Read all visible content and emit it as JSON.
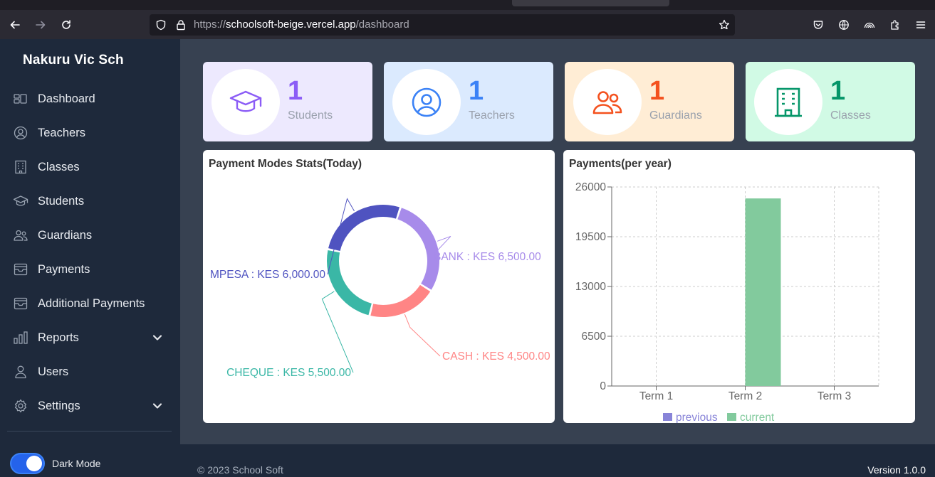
{
  "browser": {
    "url_scheme": "https://",
    "url_host": "schoolsoft-beige.vercel.app",
    "url_path": "/dashboard"
  },
  "sidebar": {
    "brand": "Nakuru Vic Sch",
    "items": [
      {
        "label": "Dashboard",
        "icon": "dashboard-icon"
      },
      {
        "label": "Teachers",
        "icon": "user-circle-icon"
      },
      {
        "label": "Classes",
        "icon": "building-icon"
      },
      {
        "label": "Students",
        "icon": "graduation-cap-icon"
      },
      {
        "label": "Guardians",
        "icon": "users-icon"
      },
      {
        "label": "Payments",
        "icon": "inbox-icon"
      },
      {
        "label": "Additional Payments",
        "icon": "inbox-icon"
      },
      {
        "label": "Reports",
        "icon": "bar-chart-icon",
        "has_submenu": true
      },
      {
        "label": "Users",
        "icon": "user-icon"
      },
      {
        "label": "Settings",
        "icon": "gear-icon",
        "has_submenu": true
      }
    ],
    "dark_mode_label": "Dark Mode",
    "dark_mode_on": true
  },
  "stats": [
    {
      "value": "1",
      "label": "Students",
      "color": "#8b5cf6",
      "bg": "#ede9fe"
    },
    {
      "value": "1",
      "label": "Teachers",
      "color": "#3b82f6",
      "bg": "#dbeafe"
    },
    {
      "value": "1",
      "label": "Guardians",
      "color": "#f4511e",
      "bg": "#ffedd5"
    },
    {
      "value": "1",
      "label": "Classes",
      "color": "#059669",
      "bg": "#d1fae5"
    }
  ],
  "payment_modes": {
    "title": "Payment Modes Stats(Today)"
  },
  "payments_year": {
    "title": "Payments(per year)"
  },
  "chart_data": [
    {
      "type": "pie",
      "title": "Payment Modes Stats(Today)",
      "labels": [
        "BANK : KES 6,500.00",
        "CASH : KES 4,500.00",
        "CHEQUE : KES 5,500.00",
        "MPESA : KES 6,000.00"
      ],
      "categories": [
        "BANK",
        "CASH",
        "CHEQUE",
        "MPESA"
      ],
      "values": [
        6500,
        4500,
        5500,
        6000
      ],
      "colors": [
        "#a78bea",
        "#ff8585",
        "#3ab7a6",
        "#4f53c0"
      ]
    },
    {
      "type": "bar",
      "title": "Payments(per year)",
      "categories": [
        "Term 1",
        "Term 2",
        "Term 3"
      ],
      "series": [
        {
          "name": "previous",
          "values": [
            0,
            0,
            0
          ],
          "color": "#8884d8"
        },
        {
          "name": "current",
          "values": [
            0,
            24500,
            0
          ],
          "color": "#82ca9d"
        }
      ],
      "ylim": [
        0,
        26000
      ],
      "yticks": [
        "0",
        "6500",
        "13000",
        "19500",
        "26000"
      ],
      "grid": true,
      "legend": "bottom"
    }
  ],
  "footer": {
    "copyright": "© 2023 School Soft",
    "version": "Version 1.0.0"
  }
}
